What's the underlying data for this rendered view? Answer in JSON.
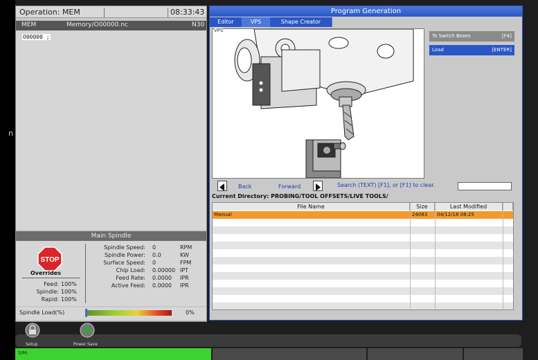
{
  "left": {
    "operation": "Operation: MEM",
    "clock": "08:33:43",
    "mem_mode": "MEM",
    "mem_file": "Memory/O00000.nc",
    "mem_n": "N30",
    "code": "O00000 ;",
    "edge_glyph": "n"
  },
  "spindle": {
    "title": "Main Spindle",
    "stop_label": "STOP",
    "overrides_label": "Overrides",
    "overrides": [
      {
        "label": "Feed:",
        "value": "100%"
      },
      {
        "label": "Spindle:",
        "value": "100%"
      },
      {
        "label": "Rapid:",
        "value": "100%"
      }
    ],
    "readouts": [
      {
        "label": "Spindle Speed:",
        "value": "0",
        "unit": "RPM"
      },
      {
        "label": "Spindle Power:",
        "value": "0.0",
        "unit": "KW"
      },
      {
        "label": "Surface Speed:",
        "value": "0",
        "unit": "FPM"
      },
      {
        "label": "Chip Load:",
        "value": "0.00000",
        "unit": "IPT"
      },
      {
        "label": "Feed Rate:",
        "value": "0.0000",
        "unit": "IPR"
      },
      {
        "label": "Active Feed:",
        "value": "0.0000",
        "unit": "IPR"
      }
    ],
    "load_label": "Spindle Load(%)",
    "load_value": "0%",
    "load_fraction": 0
  },
  "right": {
    "title": "Program Generation",
    "tabs": [
      "Editor",
      "VPS",
      "Shape Creator"
    ],
    "active_tab": "VPS",
    "vps_label": "VPS",
    "side_buttons": [
      {
        "label": "To Switch Boxes",
        "key": "[F4]"
      },
      {
        "label": "Load",
        "key": "[ENTER]"
      }
    ],
    "nav": {
      "back": "Back",
      "forward": "Forward",
      "search_hint": "Search (TEXT) [F1], or [F1] to clear.",
      "search_value": ""
    },
    "current_directory": "Current Directory: PROBING/TOOL OFFSETS/LIVE TOOLS/",
    "table": {
      "headers": [
        "File Name",
        "Size",
        "Last Modified"
      ],
      "rows": [
        {
          "name": "Manual",
          "size": "24083",
          "modified": "04/12/18 08:25"
        }
      ]
    }
  },
  "bottom": {
    "setup_label": "Setup",
    "power_save_label": "Power Save",
    "status": "SIM:"
  },
  "colors": {
    "accent": "#2a56c6",
    "selected_row": "#f39a2c",
    "status_green": "#3dd22f",
    "stop_red": "#d9262a"
  }
}
